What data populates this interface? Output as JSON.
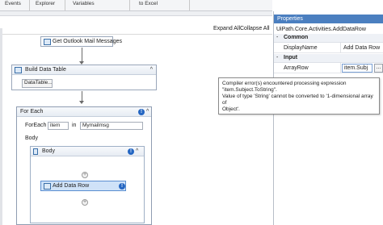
{
  "ribbon": {
    "items": [
      "Events",
      "Explorer",
      "Variables",
      "to Excel"
    ]
  },
  "designer": {
    "expand_all": "Expand All",
    "collapse_all": "Collapse All",
    "get_mail": {
      "title": "Get Outlook Mail Messages"
    },
    "build_table": {
      "title": "Build Data Table",
      "button": "DataTable..."
    },
    "for_each": {
      "title": "For Each",
      "foreach_label": "ForEach",
      "item_value": "item",
      "in_label": "in",
      "collection_value": "Mymailmsg",
      "body_label": "Body"
    },
    "body_sequence": {
      "title": "Body"
    },
    "add_data_row": {
      "title": "Add Data Row"
    }
  },
  "properties": {
    "title": "Properties",
    "type_name": "UiPath.Core.Activities.AddDataRow",
    "categories": [
      {
        "name": "Common",
        "rows": [
          {
            "name": "DisplayName",
            "value": "Add Data Row"
          }
        ]
      },
      {
        "name": "Input",
        "rows": [
          {
            "name": "ArrayRow",
            "value": "item.Subj"
          }
        ]
      }
    ],
    "dots_label": "..."
  },
  "tooltip": {
    "line1": "Compiler error(s) encountered processing expression",
    "line2": "\"item.Subject.ToString\".",
    "line3": "Value of type 'String' cannot be converted to '1-dimensional array of",
    "line4": "Object'."
  },
  "icons": {
    "error": "!",
    "collapse": "^",
    "plus": "+",
    "toggle": "-"
  },
  "colors": {
    "panel_header": "#4b7fc0",
    "error_icon": "#2466c2",
    "selected_activity": "#cfe2f8"
  }
}
